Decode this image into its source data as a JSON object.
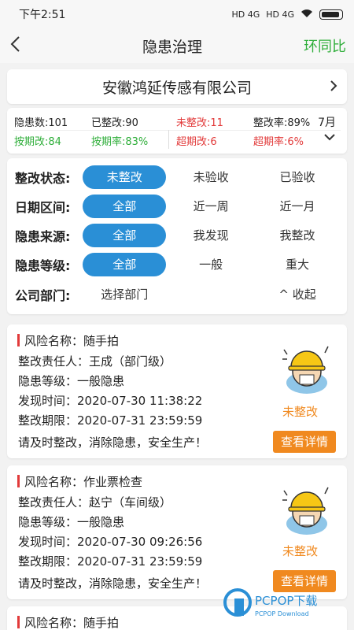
{
  "status": {
    "time": "下午2:51",
    "signal": "HD 4G",
    "signal2": "HD 4G"
  },
  "nav": {
    "title": "隐患治理",
    "right": "环同比"
  },
  "company": {
    "name": "安徽鸿延传感有限公司"
  },
  "stats": {
    "total": "隐患数:101",
    "done": "已整改:90",
    "undone": "未整改:11",
    "rate": "整改率:89%",
    "month": "7月",
    "ontime": "按期改:84",
    "ontime_rate": "按期率:83%",
    "overdue": "超期改:6",
    "overdue_rate": "超期率:6%"
  },
  "filters": {
    "status": {
      "label": "整改状态:",
      "options": [
        "未整改",
        "未验收",
        "已验收"
      ]
    },
    "date": {
      "label": "日期区间:",
      "options": [
        "全部",
        "近一周",
        "近一月"
      ]
    },
    "source": {
      "label": "隐患来源:",
      "options": [
        "全部",
        "我发现",
        "我整改"
      ]
    },
    "level": {
      "label": "隐患等级:",
      "options": [
        "全部",
        "一般",
        "重大"
      ]
    },
    "dept": {
      "label": "公司部门:",
      "select": "选择部门",
      "collapse": "收起"
    }
  },
  "cards": [
    {
      "risk": "风险名称：随手拍",
      "owner": "整改责任人：王成（部门级）",
      "level": "隐患等级：一般隐患",
      "found": "发现时间：2020-07-30 11:38:22",
      "deadline": "整改期限：2020-07-31 23:59:59",
      "note": "请及时整改，消除隐患，安全生产！",
      "state": "未整改",
      "action": "查看详情"
    },
    {
      "risk": "风险名称：作业票检查",
      "owner": "整改责任人：赵宁（车间级）",
      "level": "隐患等级：一般隐患",
      "found": "发现时间：2020-07-30 09:26:56",
      "deadline": "整改期限：2020-07-31 23:59:59",
      "note": "请及时整改，消除隐患，安全生产！",
      "state": "未整改",
      "action": "查看详情"
    },
    {
      "risk": "风险名称：随手拍"
    }
  ],
  "watermark": {
    "brand": "PCPOP下载",
    "sub": "PCPOP Download"
  }
}
